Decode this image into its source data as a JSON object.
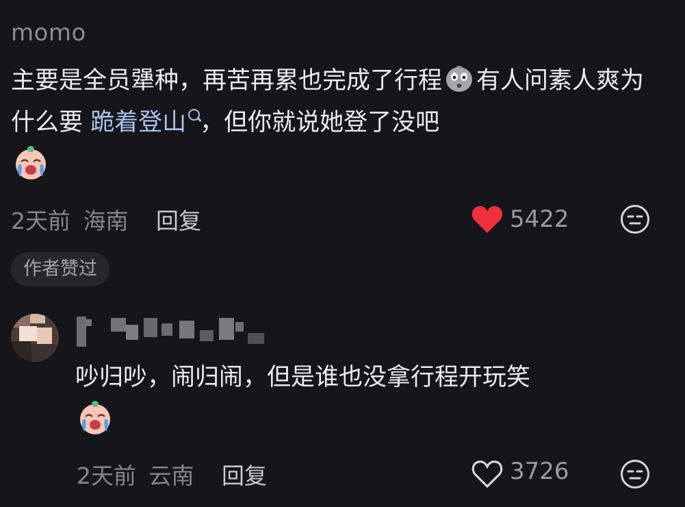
{
  "comment1": {
    "username": "momo",
    "text_a": "主要是全员犟种，再苦再累也完成了行程",
    "text_b": "有人问素人爽为什么要",
    "link_text": "跪着登山",
    "text_c": "，但你就说她登了没吧",
    "time": "2天前",
    "location": "海南",
    "reply_label": "回复",
    "like_count": "5422",
    "liked": true,
    "author_badge": "作者赞过"
  },
  "comment2": {
    "text": "吵归吵，闹归闹，但是谁也没拿行程开玩笑",
    "time": "2天前",
    "location": "云南",
    "reply_label": "回复",
    "like_count": "3726",
    "liked": false
  },
  "colors": {
    "background": "#16161a",
    "link": "#a9c3ec",
    "heart": "#f0303d"
  },
  "icons": [
    "grimace-emoji-icon",
    "crying-face-emoji-icon",
    "heart-icon",
    "dismissive-face-icon",
    "search-icon"
  ]
}
